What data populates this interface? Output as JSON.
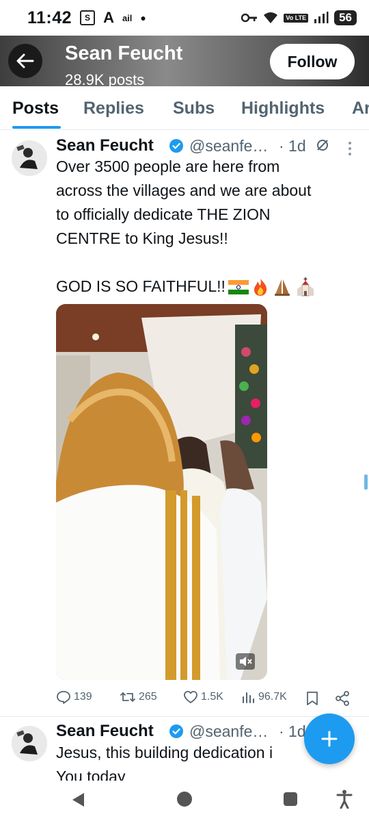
{
  "status_bar": {
    "time": "11:42",
    "icons": [
      "S-box-icon",
      "a-logo-icon",
      "signal-small-icon",
      "dot-icon"
    ],
    "right_icons": [
      "key-icon",
      "wifi-icon",
      "volte-icon",
      "signal-icon"
    ],
    "volte": "Vo LTE",
    "battery": "56"
  },
  "header": {
    "name": "Sean Feucht",
    "post_count": "28.9K posts",
    "follow_label": "Follow"
  },
  "tabs": [
    {
      "label": "Posts",
      "active": true
    },
    {
      "label": "Replies",
      "active": false
    },
    {
      "label": "Subs",
      "active": false
    },
    {
      "label": "Highlights",
      "active": false
    },
    {
      "label": "Ar",
      "active": false
    }
  ],
  "tweet1": {
    "name": "Sean Feucht",
    "handle": "@seanfe…",
    "time": "· 1d",
    "text_lines": [
      "Over 3500 people are here from",
      "across the villages and we are about",
      "to officially dedicate THE ZION",
      "CENTRE to King Jesus!!"
    ],
    "text_line2": "GOD IS SO FAITHFUL!!",
    "emojis": [
      "india-flag-icon",
      "fire-icon",
      "folded-hands-icon",
      "church-icon"
    ],
    "stats": {
      "replies": "139",
      "reposts": "265",
      "likes": "1.5K",
      "views": "96.7K"
    }
  },
  "tweet2": {
    "name": "Sean Feucht",
    "handle": "@seanfe…",
    "time": "· 1d",
    "text_line1": "Jesus, this building dedication i",
    "text_line2": "You today"
  },
  "colors": {
    "accent": "#1d9bf0",
    "text_primary": "#0f1419",
    "text_secondary": "#536471"
  }
}
